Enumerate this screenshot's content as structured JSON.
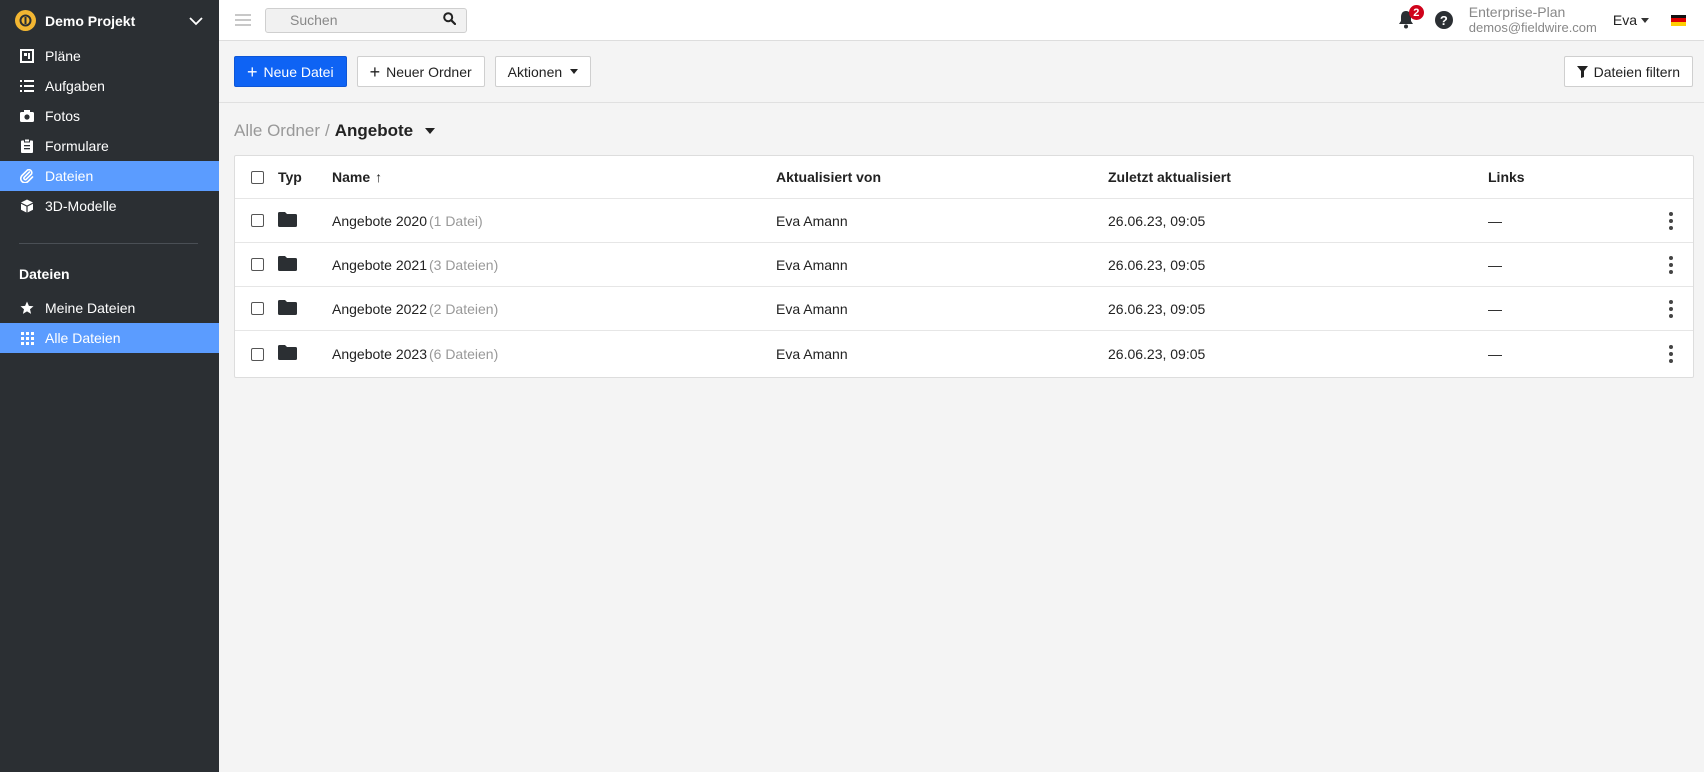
{
  "sidebar": {
    "project_name": "Demo Projekt",
    "nav": [
      {
        "label": "Pläne",
        "icon": "plans-icon"
      },
      {
        "label": "Aufgaben",
        "icon": "tasks-list-icon"
      },
      {
        "label": "Fotos",
        "icon": "camera-icon"
      },
      {
        "label": "Formulare",
        "icon": "clipboard-icon"
      },
      {
        "label": "Dateien",
        "icon": "paperclip-icon",
        "active": true
      },
      {
        "label": "3D-Modelle",
        "icon": "cube-icon"
      }
    ],
    "section_title": "Dateien",
    "sub_nav": [
      {
        "label": "Meine Dateien",
        "icon": "star-icon"
      },
      {
        "label": "Alle Dateien",
        "icon": "grid-icon",
        "active": true
      }
    ],
    "active_color": "#5b9cff",
    "bg_color": "#2b2f33"
  },
  "topbar": {
    "search_placeholder": "Suchen",
    "notification_count": "2",
    "help_label": "?",
    "plan_name": "Enterprise-Plan",
    "email": "demos@fieldwire.com",
    "user_name": "Eva",
    "flag": "germany-flag-icon"
  },
  "toolbar": {
    "new_file": "Neue Datei",
    "new_folder": "Neuer Ordner",
    "actions": "Aktionen",
    "filter": "Dateien filtern",
    "primary_color": "#0e63f4"
  },
  "breadcrumb": {
    "root": "Alle Ordner",
    "separator": "/",
    "current": "Angebote"
  },
  "table": {
    "columns": {
      "type": "Typ",
      "name": "Name",
      "updated_by": "Aktualisiert von",
      "last_updated": "Zuletzt aktualisiert",
      "links": "Links"
    },
    "rows": [
      {
        "name": "Angebote 2020",
        "count": "(1 Datei)",
        "updated_by": "Eva Amann",
        "last_updated": "26.06.23, 09:05",
        "links": "—"
      },
      {
        "name": "Angebote 2021",
        "count": "(3 Dateien)",
        "updated_by": "Eva Amann",
        "last_updated": "26.06.23, 09:05",
        "links": "—"
      },
      {
        "name": "Angebote 2022",
        "count": "(2 Dateien)",
        "updated_by": "Eva Amann",
        "last_updated": "26.06.23, 09:05",
        "links": "—"
      },
      {
        "name": "Angebote 2023",
        "count": "(6 Dateien)",
        "updated_by": "Eva Amann",
        "last_updated": "26.06.23, 09:05",
        "links": "—"
      }
    ]
  }
}
